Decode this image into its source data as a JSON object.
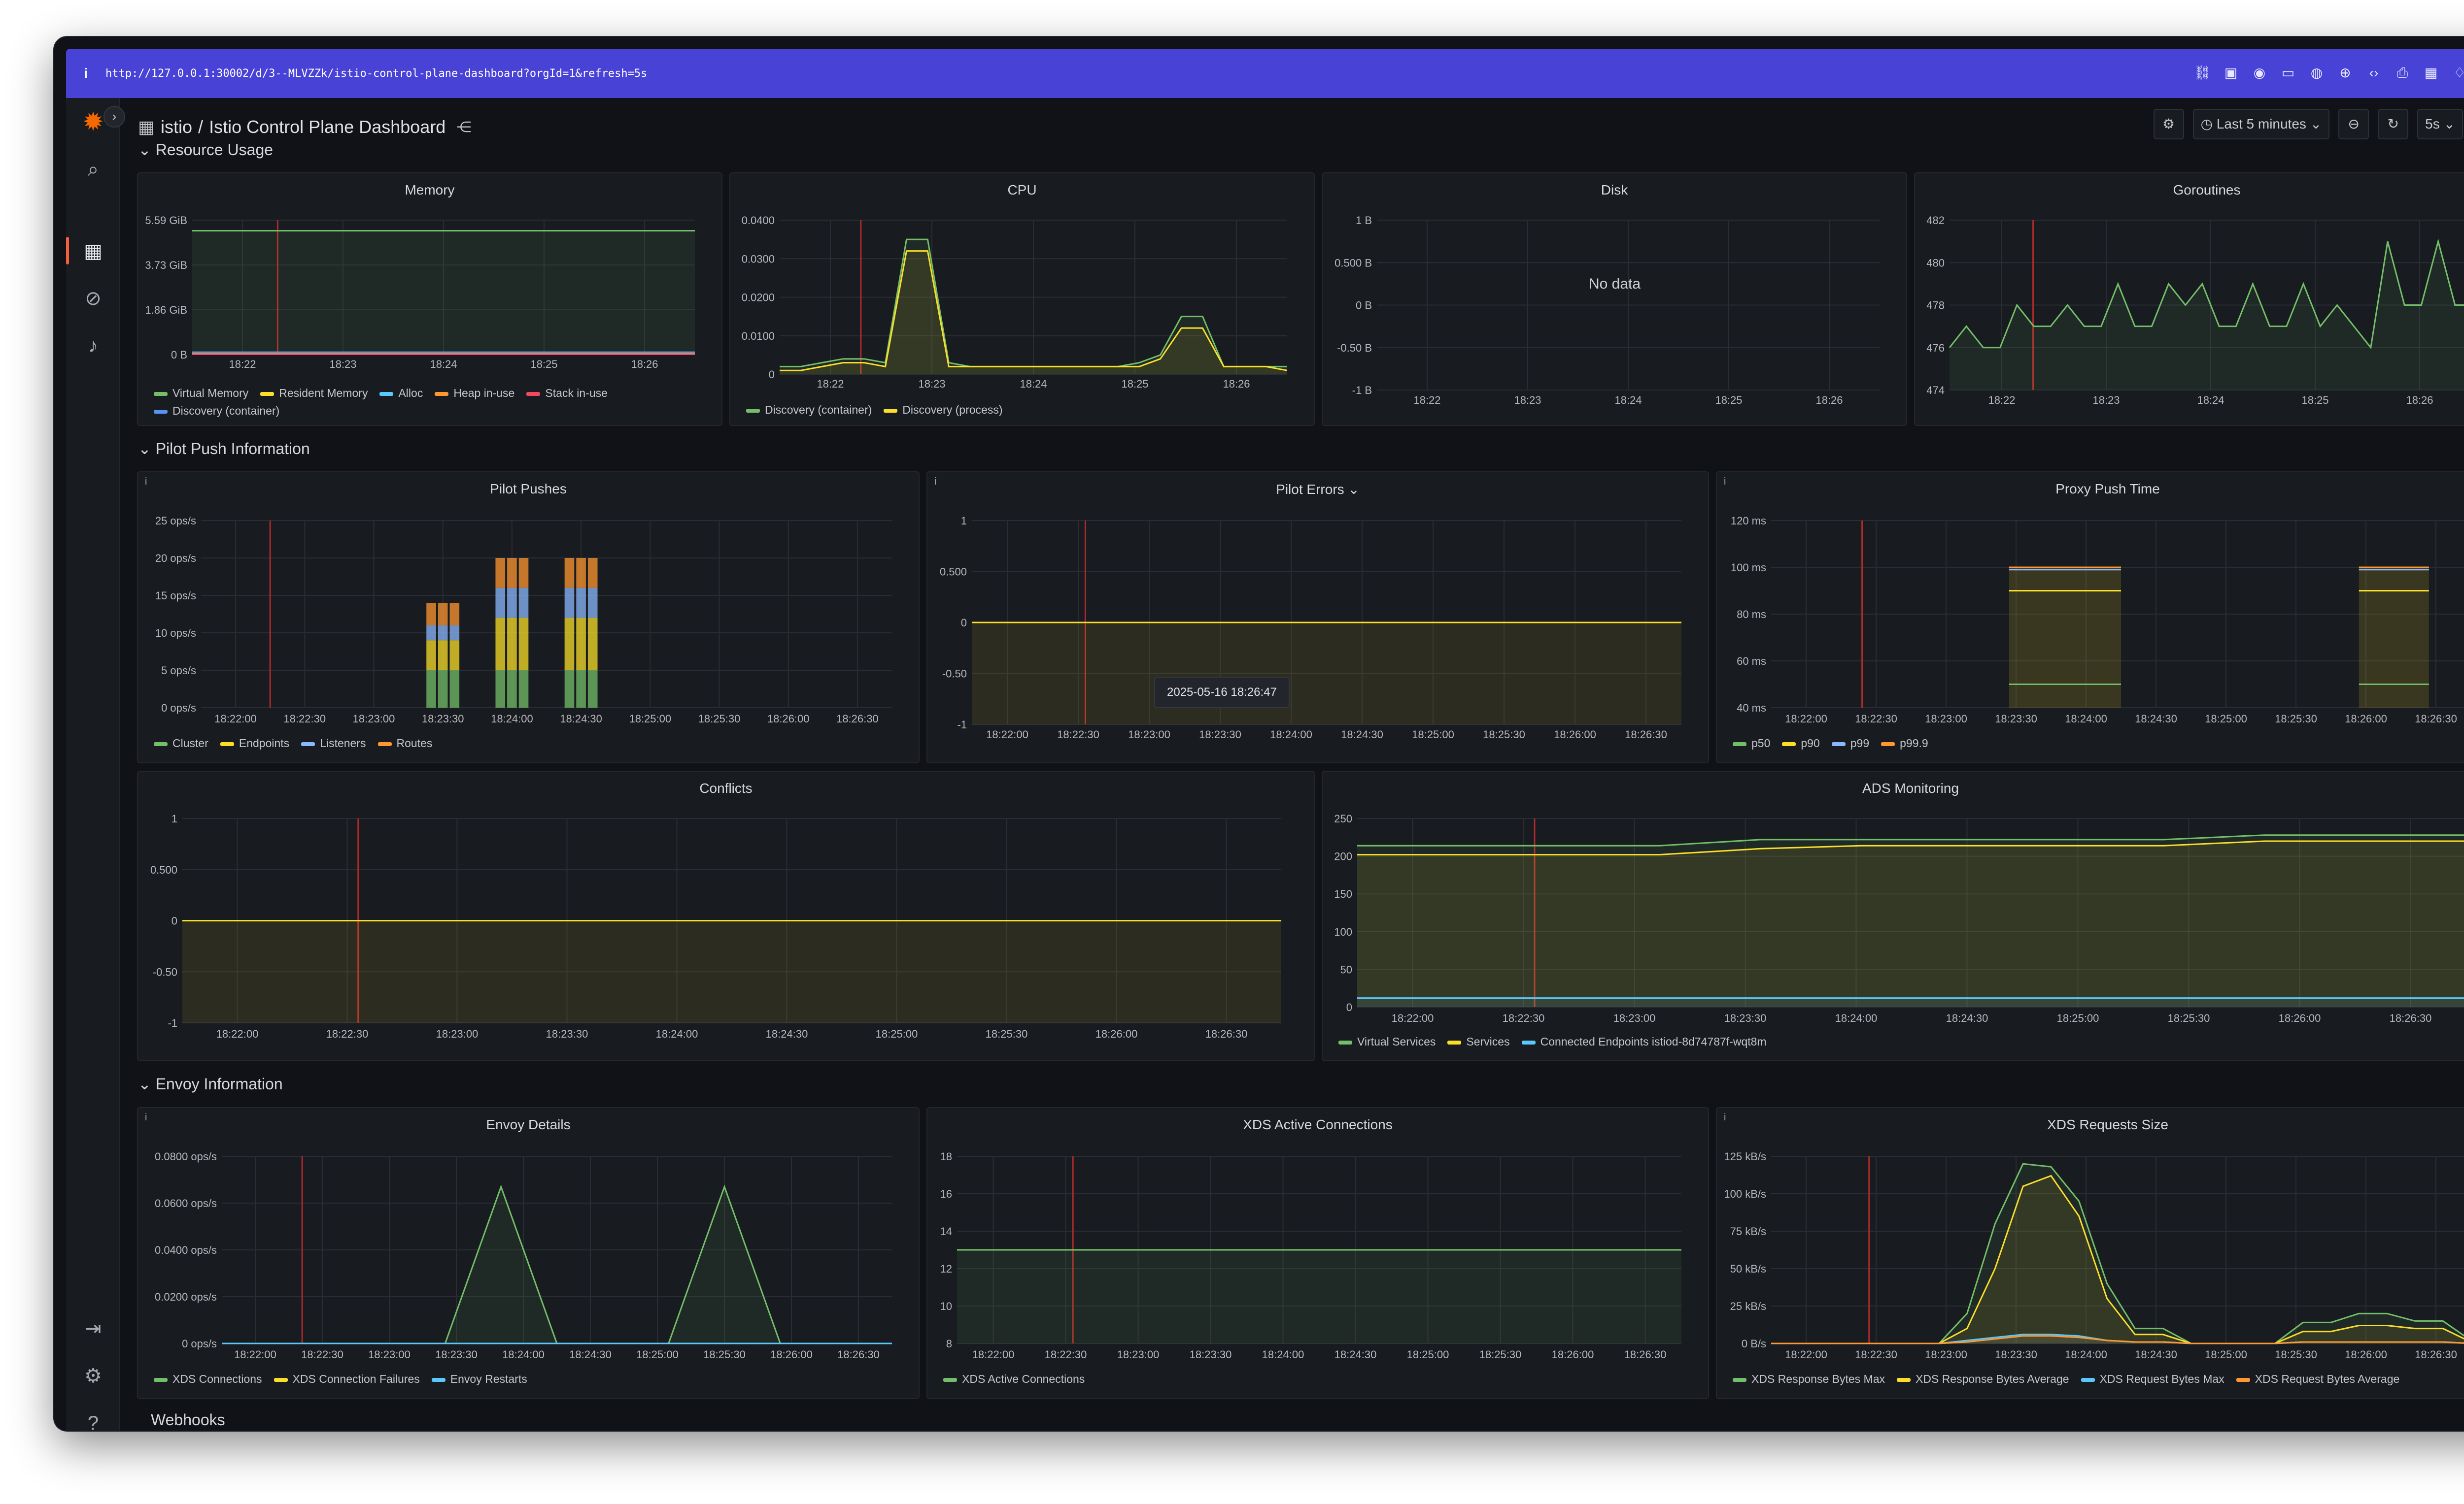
{
  "browser": {
    "url": "http://127.0.0.1:30002/d/3--MLVZZk/istio-control-plane-dashboard?orgId=1&refresh=5s"
  },
  "header": {
    "folder": "istio",
    "separator": "/",
    "title": "Istio Control Plane Dashboard",
    "time_range": "Last 5 minutes",
    "refresh": "5s"
  },
  "sections": {
    "resource_usage": "Resource Usage",
    "pilot_push": "Pilot Push Information",
    "envoy": "Envoy Information",
    "webhooks": "Webhooks"
  },
  "panels": {
    "memory": {
      "title": "Memory"
    },
    "cpu": {
      "title": "CPU"
    },
    "disk": {
      "title": "Disk",
      "nodata": "No data"
    },
    "goroutines": {
      "title": "Goroutines"
    },
    "pilot_pushes": {
      "title": "Pilot Pushes"
    },
    "pilot_errors": {
      "title": "Pilot Errors",
      "tooltip": "2025-05-16 18:26:47"
    },
    "proxy_push_time": {
      "title": "Proxy Push Time"
    },
    "conflicts": {
      "title": "Conflicts"
    },
    "ads_monitoring": {
      "title": "ADS Monitoring"
    },
    "envoy_details": {
      "title": "Envoy Details"
    },
    "xds_active": {
      "title": "XDS Active Connections"
    },
    "xds_requests": {
      "title": "XDS Requests Size"
    }
  },
  "colors": {
    "green": "#73bf69",
    "yellow": "#fade2a",
    "blue": "#8ab8ff",
    "orange": "#ff9830",
    "red": "#f2495c",
    "cyan": "#5ac8fa",
    "annotation": "#b02a2a"
  },
  "chart_data": [
    {
      "id": "memory",
      "type": "line",
      "title": "Memory",
      "x": [
        "18:22",
        "18:23",
        "18:24",
        "18:25",
        "18:26"
      ],
      "yticks": [
        "5.59 GiB",
        "3.73 GiB",
        "1.86 GiB",
        "0 B"
      ],
      "ylim": [
        0,
        5.59
      ],
      "series": [
        {
          "name": "Virtual Memory",
          "color": "#73bf69",
          "values": [
            5.15,
            5.15,
            5.15,
            5.15,
            5.15
          ]
        },
        {
          "name": "Resident Memory",
          "color": "#fade2a",
          "values": [
            0.08,
            0.08,
            0.08,
            0.08,
            0.08
          ]
        },
        {
          "name": "Alloc",
          "color": "#5ac8fa",
          "values": [
            0.04,
            0.04,
            0.04,
            0.04,
            0.04
          ]
        },
        {
          "name": "Heap in-use",
          "color": "#ff9830",
          "values": [
            0.05,
            0.05,
            0.05,
            0.05,
            0.05
          ]
        },
        {
          "name": "Stack in-use",
          "color": "#f2495c",
          "values": [
            0.01,
            0.01,
            0.01,
            0.01,
            0.01
          ]
        },
        {
          "name": "Discovery (container)",
          "color": "#5794f2",
          "values": [
            0.1,
            0.1,
            0.1,
            0.1,
            0.1
          ]
        }
      ]
    },
    {
      "id": "cpu",
      "type": "line",
      "title": "CPU",
      "x": [
        "18:22",
        "18:23",
        "18:24",
        "18:25",
        "18:26"
      ],
      "yticks": [
        "0.0400",
        "0.0300",
        "0.0200",
        "0.0100",
        "0"
      ],
      "ylim": [
        0,
        0.04
      ],
      "series": [
        {
          "name": "Discovery (container)",
          "color": "#73bf69",
          "values": [
            0.002,
            0.002,
            0.003,
            0.004,
            0.004,
            0.003,
            0.035,
            0.035,
            0.003,
            0.002,
            0.002,
            0.002,
            0.002,
            0.002,
            0.002,
            0.002,
            0.002,
            0.003,
            0.005,
            0.015,
            0.015,
            0.002,
            0.002,
            0.002,
            0.002
          ]
        },
        {
          "name": "Discovery (process)",
          "color": "#fade2a",
          "values": [
            0.001,
            0.001,
            0.002,
            0.003,
            0.003,
            0.002,
            0.032,
            0.032,
            0.002,
            0.002,
            0.002,
            0.002,
            0.002,
            0.002,
            0.002,
            0.002,
            0.002,
            0.002,
            0.004,
            0.012,
            0.012,
            0.002,
            0.002,
            0.002,
            0.001
          ]
        }
      ]
    },
    {
      "id": "disk",
      "type": "line",
      "title": "Disk",
      "x": [
        "18:22",
        "18:23",
        "18:24",
        "18:25",
        "18:26"
      ],
      "yticks": [
        "1 B",
        "0.500 B",
        "0 B",
        "-0.50 B",
        "-1 B"
      ],
      "ylim": [
        -1,
        1
      ],
      "series": []
    },
    {
      "id": "goroutines",
      "type": "area",
      "title": "Goroutines",
      "x": [
        "18:22",
        "18:23",
        "18:24",
        "18:25",
        "18:26"
      ],
      "yticks": [
        "482",
        "480",
        "478",
        "476",
        "474"
      ],
      "ylim": [
        474,
        482
      ],
      "series": [
        {
          "name": "goroutines",
          "color": "#73bf69",
          "values": [
            476,
            477,
            476,
            476,
            478,
            477,
            477,
            478,
            477,
            477,
            479,
            477,
            477,
            479,
            478,
            479,
            477,
            477,
            479,
            477,
            477,
            479,
            477,
            478,
            477,
            476,
            481,
            478,
            478,
            481,
            478,
            478
          ]
        }
      ]
    },
    {
      "id": "pilot_pushes",
      "type": "bar",
      "title": "Pilot Pushes",
      "x": [
        "18:22:00",
        "18:22:30",
        "18:23:00",
        "18:23:30",
        "18:24:00",
        "18:24:30",
        "18:25:00",
        "18:25:30",
        "18:26:00",
        "18:26:30"
      ],
      "yticks": [
        "25 ops/s",
        "20 ops/s",
        "15 ops/s",
        "10 ops/s",
        "5 ops/s",
        "0 ops/s"
      ],
      "ylim": [
        0,
        25
      ],
      "series": [
        {
          "name": "Cluster",
          "color": "#73bf69",
          "values": [
            0,
            0,
            0,
            5,
            5,
            5,
            0,
            0,
            0,
            0
          ]
        },
        {
          "name": "Endpoints",
          "color": "#fade2a",
          "values": [
            0,
            0,
            0,
            4,
            7,
            7,
            0,
            0,
            0,
            0
          ]
        },
        {
          "name": "Listeners",
          "color": "#8ab8ff",
          "values": [
            0,
            0,
            0,
            2,
            4,
            4,
            0,
            0,
            0,
            0
          ]
        },
        {
          "name": "Routes",
          "color": "#ff9830",
          "values": [
            0,
            0,
            0,
            3,
            4,
            4,
            0,
            0,
            0,
            0
          ]
        }
      ]
    },
    {
      "id": "pilot_errors",
      "type": "line",
      "title": "Pilot Errors",
      "x": [
        "18:22:00",
        "18:22:30",
        "18:23:00",
        "18:23:30",
        "18:24:00",
        "18:24:30",
        "18:25:00",
        "18:25:30",
        "18:26:00",
        "18:26:30"
      ],
      "yticks": [
        "1",
        "0.500",
        "0",
        "-0.50",
        "-1"
      ],
      "ylim": [
        -1,
        1
      ],
      "series": [
        {
          "name": "errors",
          "color": "#fade2a",
          "values": [
            0,
            0,
            0,
            0,
            0,
            0,
            0,
            0,
            0,
            0
          ]
        }
      ]
    },
    {
      "id": "proxy_push_time",
      "type": "area",
      "title": "Proxy Push Time",
      "x": [
        "18:22:00",
        "18:22:30",
        "18:23:00",
        "18:23:30",
        "18:24:00",
        "18:24:30",
        "18:25:00",
        "18:25:30",
        "18:26:00",
        "18:26:30"
      ],
      "yticks": [
        "120 ms",
        "100 ms",
        "80 ms",
        "60 ms",
        "40 ms"
      ],
      "ylim": [
        40,
        120
      ],
      "series": [
        {
          "name": "p50",
          "color": "#73bf69",
          "values": [
            50,
            50
          ]
        },
        {
          "name": "p90",
          "color": "#fade2a",
          "values": [
            90,
            90
          ]
        },
        {
          "name": "p99",
          "color": "#8ab8ff",
          "values": [
            99,
            99
          ]
        },
        {
          "name": "p99.9",
          "color": "#ff9830",
          "values": [
            100,
            100
          ]
        }
      ]
    },
    {
      "id": "conflicts",
      "type": "line",
      "title": "Conflicts",
      "x": [
        "18:22:00",
        "18:22:30",
        "18:23:00",
        "18:23:30",
        "18:24:00",
        "18:24:30",
        "18:25:00",
        "18:25:30",
        "18:26:00",
        "18:26:30"
      ],
      "yticks": [
        "1",
        "0.500",
        "0",
        "-0.50",
        "-1"
      ],
      "ylim": [
        -1,
        1
      ],
      "series": [
        {
          "name": "conflicts",
          "color": "#fade2a",
          "values": [
            0,
            0,
            0,
            0,
            0,
            0,
            0,
            0,
            0,
            0
          ]
        }
      ]
    },
    {
      "id": "ads_monitoring",
      "type": "area",
      "title": "ADS Monitoring",
      "x": [
        "18:22:00",
        "18:22:30",
        "18:23:00",
        "18:23:30",
        "18:24:00",
        "18:24:30",
        "18:25:00",
        "18:25:30",
        "18:26:00",
        "18:26:30"
      ],
      "yticks": [
        "250",
        "200",
        "150",
        "100",
        "50",
        "0"
      ],
      "ylim": [
        0,
        250
      ],
      "series": [
        {
          "name": "Virtual Services",
          "color": "#73bf69",
          "values": [
            214,
            214,
            214,
            214,
            222,
            222,
            222,
            222,
            222,
            228,
            228,
            228
          ]
        },
        {
          "name": "Services",
          "color": "#fade2a",
          "values": [
            202,
            202,
            202,
            202,
            210,
            214,
            214,
            214,
            214,
            220,
            220,
            220
          ]
        },
        {
          "name": "Connected Endpoints istiod-8d74787f-wqt8m",
          "color": "#5ac8fa",
          "values": [
            12,
            12,
            12,
            12,
            12,
            12,
            12,
            12,
            12,
            12,
            12,
            12
          ]
        }
      ]
    },
    {
      "id": "envoy_details",
      "type": "line",
      "title": "Envoy Details",
      "x": [
        "18:22:00",
        "18:22:30",
        "18:23:00",
        "18:23:30",
        "18:24:00",
        "18:24:30",
        "18:25:00",
        "18:25:30",
        "18:26:00",
        "18:26:30"
      ],
      "yticks": [
        "0.0800 ops/s",
        "0.0600 ops/s",
        "0.0400 ops/s",
        "0.0200 ops/s",
        "0 ops/s"
      ],
      "ylim": [
        0,
        0.08
      ],
      "series": [
        {
          "name": "XDS Connections",
          "color": "#73bf69",
          "values": [
            0,
            0,
            0,
            0,
            0,
            0.067,
            0,
            0,
            0,
            0.067,
            0,
            0,
            0
          ]
        },
        {
          "name": "XDS Connection Failures",
          "color": "#fade2a",
          "values": [
            0,
            0,
            0,
            0,
            0,
            0,
            0,
            0,
            0,
            0,
            0,
            0,
            0
          ]
        },
        {
          "name": "Envoy Restarts",
          "color": "#5ac8fa",
          "values": [
            0,
            0,
            0,
            0,
            0,
            0,
            0,
            0,
            0,
            0,
            0,
            0,
            0
          ]
        }
      ]
    },
    {
      "id": "xds_active",
      "type": "line",
      "title": "XDS Active Connections",
      "x": [
        "18:22:00",
        "18:22:30",
        "18:23:00",
        "18:23:30",
        "18:24:00",
        "18:24:30",
        "18:25:00",
        "18:25:30",
        "18:26:00",
        "18:26:30"
      ],
      "yticks": [
        "18",
        "16",
        "14",
        "12",
        "10",
        "8"
      ],
      "ylim": [
        8,
        18
      ],
      "series": [
        {
          "name": "XDS Active Connections",
          "color": "#73bf69",
          "values": [
            13,
            13,
            13,
            13,
            13,
            13,
            13,
            13,
            13,
            13
          ]
        }
      ]
    },
    {
      "id": "xds_requests",
      "type": "line",
      "title": "XDS Requests Size",
      "x": [
        "18:22:00",
        "18:22:30",
        "18:23:00",
        "18:23:30",
        "18:24:00",
        "18:24:30",
        "18:25:00",
        "18:25:30",
        "18:26:00",
        "18:26:30"
      ],
      "yticks": [
        "125 kB/s",
        "100 kB/s",
        "75 kB/s",
        "50 kB/s",
        "25 kB/s",
        "0 B/s"
      ],
      "ylim": [
        0,
        125
      ],
      "series": [
        {
          "name": "XDS Response Bytes Max",
          "color": "#73bf69",
          "values": [
            0,
            0,
            0,
            0,
            0,
            0,
            0,
            20,
            80,
            120,
            118,
            95,
            40,
            10,
            10,
            0,
            0,
            0,
            0,
            14,
            14,
            20,
            20,
            15,
            15,
            2
          ]
        },
        {
          "name": "XDS Response Bytes Average",
          "color": "#fade2a",
          "values": [
            0,
            0,
            0,
            0,
            0,
            0,
            0,
            10,
            50,
            105,
            112,
            85,
            30,
            6,
            6,
            0,
            0,
            0,
            0,
            8,
            8,
            12,
            12,
            10,
            10,
            1
          ]
        },
        {
          "name": "XDS Request Bytes Max",
          "color": "#5ac8fa",
          "values": [
            0,
            0,
            0,
            0,
            0,
            0,
            0,
            2,
            4,
            6,
            6,
            5,
            2,
            1,
            1,
            0,
            0,
            0,
            0,
            1,
            1,
            1,
            1,
            1,
            1,
            0
          ]
        },
        {
          "name": "XDS Request Bytes Average",
          "color": "#ff9830",
          "values": [
            0,
            0,
            0,
            0,
            0,
            0,
            0,
            1,
            3,
            5,
            5,
            4,
            2,
            1,
            1,
            0,
            0,
            0,
            0,
            1,
            1,
            1,
            1,
            1,
            1,
            0
          ]
        }
      ]
    }
  ]
}
